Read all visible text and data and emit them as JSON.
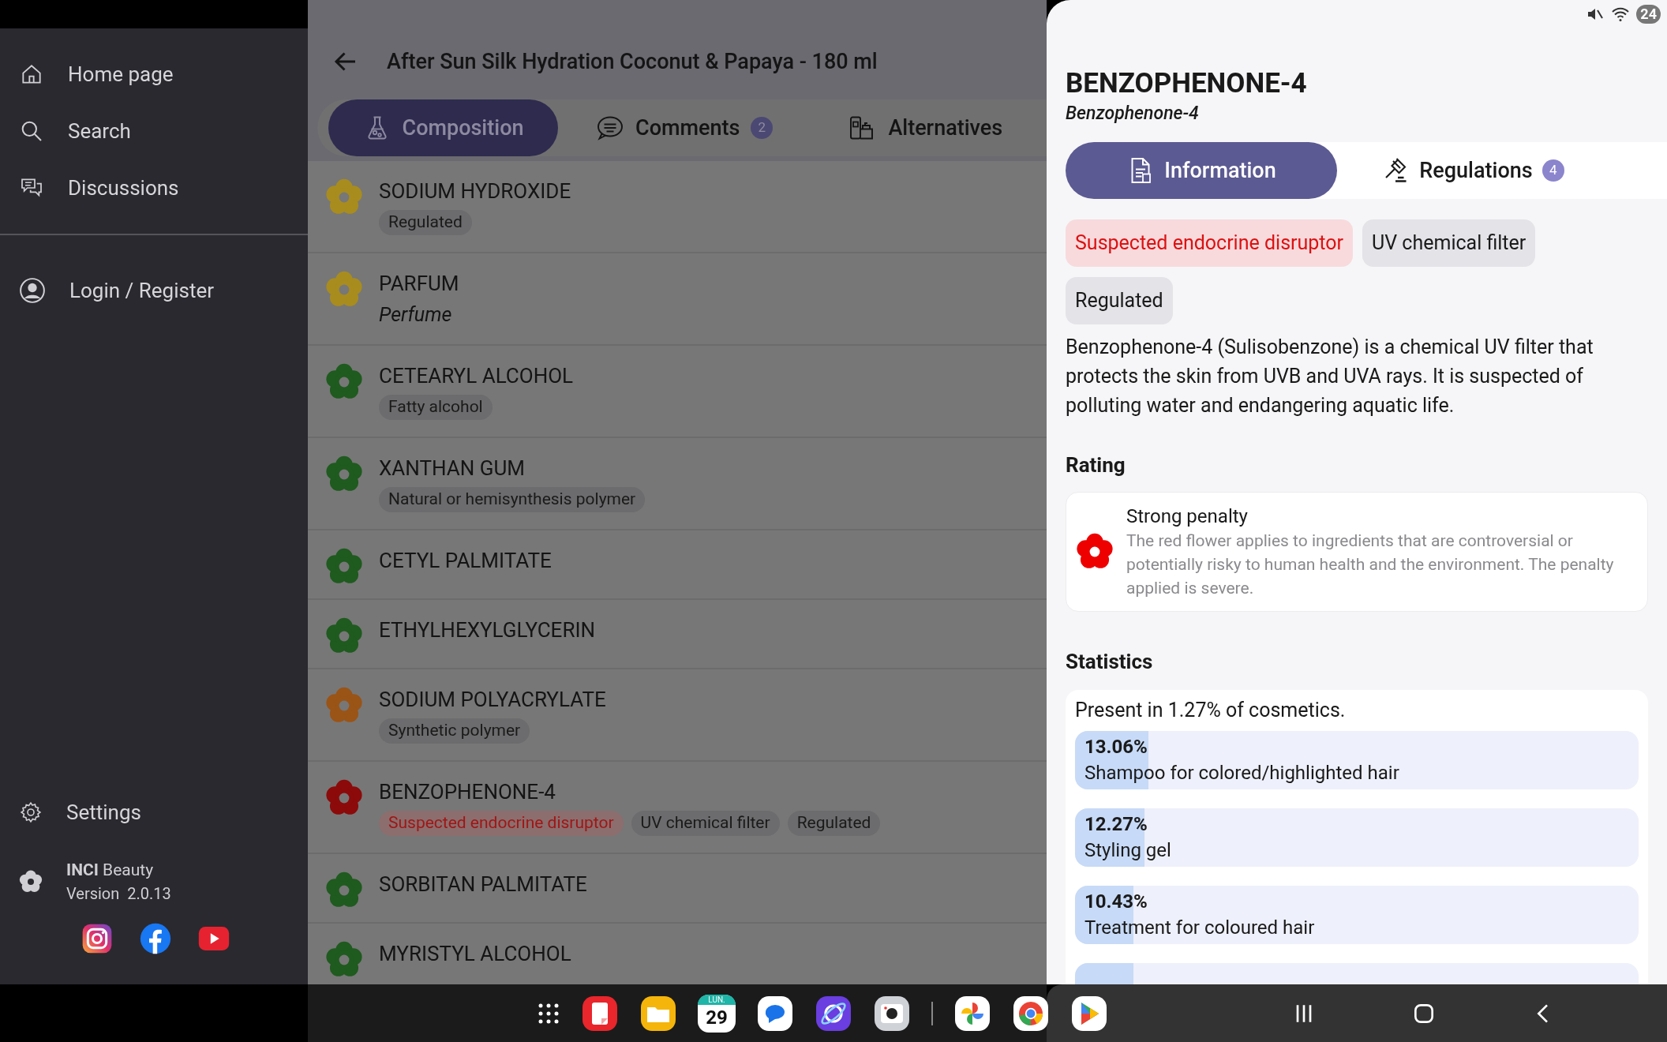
{
  "sidebar": {
    "items": [
      {
        "kind": "home",
        "label": "Home page"
      },
      {
        "kind": "search",
        "label": "Search"
      },
      {
        "kind": "chat",
        "label": "Discussions"
      }
    ],
    "account": {
      "label": "Login / Register"
    },
    "settings": {
      "label": "Settings"
    },
    "app": {
      "brand": "INCI",
      "name": "Beauty",
      "version": "Version  2.0.13"
    },
    "social": [
      {
        "kind": "instagram"
      },
      {
        "kind": "facebook"
      },
      {
        "kind": "youtube"
      }
    ]
  },
  "product": {
    "title": "After Sun Silk Hydration Coconut & Papaya - 180 ml",
    "tabs": [
      {
        "label": "Composition",
        "kind": "flask",
        "selected": true
      },
      {
        "label": "Comments",
        "kind": "comment",
        "badge": "2",
        "selected": false
      },
      {
        "label": "Alternatives",
        "kind": "products",
        "selected": false
      }
    ],
    "ingredients": [
      {
        "name": "SODIUM HYDROXIDE",
        "color": "#a88c1e",
        "tags": [
          {
            "label": "Regulated",
            "kind": "neutral"
          }
        ]
      },
      {
        "name": "PARFUM",
        "color": "#a88c1e",
        "subtitle": "Perfume"
      },
      {
        "name": "CETEARYL ALCOHOL",
        "color": "#1f5a1f",
        "tags": [
          {
            "label": "Fatty alcohol",
            "kind": "neutral"
          }
        ]
      },
      {
        "name": "XANTHAN GUM",
        "color": "#1f5a1f",
        "tags": [
          {
            "label": "Natural or hemisynthesis polymer",
            "kind": "neutral"
          }
        ]
      },
      {
        "name": "CETYL PALMITATE",
        "color": "#1f5a1f"
      },
      {
        "name": "ETHYLHEXYLGLYCERIN",
        "color": "#1f5a1f"
      },
      {
        "name": "SODIUM POLYACRYLATE",
        "color": "#9a5416",
        "tags": [
          {
            "label": "Synthetic polymer",
            "kind": "neutral"
          }
        ]
      },
      {
        "name": "BENZOPHENONE-4",
        "color": "#8c0a0a",
        "tags": [
          {
            "label": "Suspected endocrine disruptor",
            "kind": "warning"
          },
          {
            "label": "UV chemical filter",
            "kind": "neutral"
          },
          {
            "label": "Regulated",
            "kind": "neutral"
          }
        ]
      },
      {
        "name": "SORBITAN PALMITATE",
        "color": "#1f5a1f"
      },
      {
        "name": "MYRISTYL ALCOHOL",
        "color": "#1f5a1f"
      }
    ]
  },
  "detail": {
    "title": "BENZOPHENONE-4",
    "subtitle": "Benzophenone-4",
    "tabs": [
      {
        "label": "Information",
        "kind": "document",
        "selected": true
      },
      {
        "label": "Regulations",
        "kind": "gavel",
        "badge": "4",
        "selected": false
      }
    ],
    "tags": [
      {
        "label": "Suspected endocrine disruptor",
        "kind": "warning"
      },
      {
        "label": "UV chemical filter",
        "kind": "neutral"
      },
      {
        "label": "Regulated",
        "kind": "neutral"
      }
    ],
    "description": "Benzophenone-4 (Sulisobenzone) is a chemical UV filter that protects the skin from UVB and UVA rays. It is suspected of polluting water and endangering aquatic life.",
    "rating_heading": "Rating",
    "rating": {
      "title": "Strong penalty",
      "color": "#ee0000",
      "text": "The red flower applies to ingredients that are controversial or potentially risky to human health and the environment. The penalty applied is severe."
    },
    "statistics_heading": "Statistics",
    "presence": "Present in 1.27% of cosmetics.",
    "stats": [
      {
        "percent": "13.06%",
        "label": "Shampoo for colored/highlighted hair",
        "level": 0.1306
      },
      {
        "percent": "12.27%",
        "label": "Styling gel",
        "level": 0.1227
      },
      {
        "percent": "10.43%",
        "label": "Treatment for coloured hair",
        "level": 0.1043
      },
      {
        "level": 0.1043
      }
    ]
  },
  "status_bar": {
    "battery": "24"
  },
  "taskbar": {
    "apps": [
      {
        "kind": "grid"
      },
      {
        "kind": "notes"
      },
      {
        "kind": "folder"
      },
      {
        "kind": "calendar",
        "day_name": "LUN.",
        "day": "29"
      },
      {
        "kind": "messages"
      },
      {
        "kind": "browser"
      },
      {
        "kind": "camera"
      },
      {
        "kind": "separator"
      },
      {
        "kind": "photos"
      },
      {
        "kind": "chrome"
      },
      {
        "kind": "play"
      }
    ]
  }
}
